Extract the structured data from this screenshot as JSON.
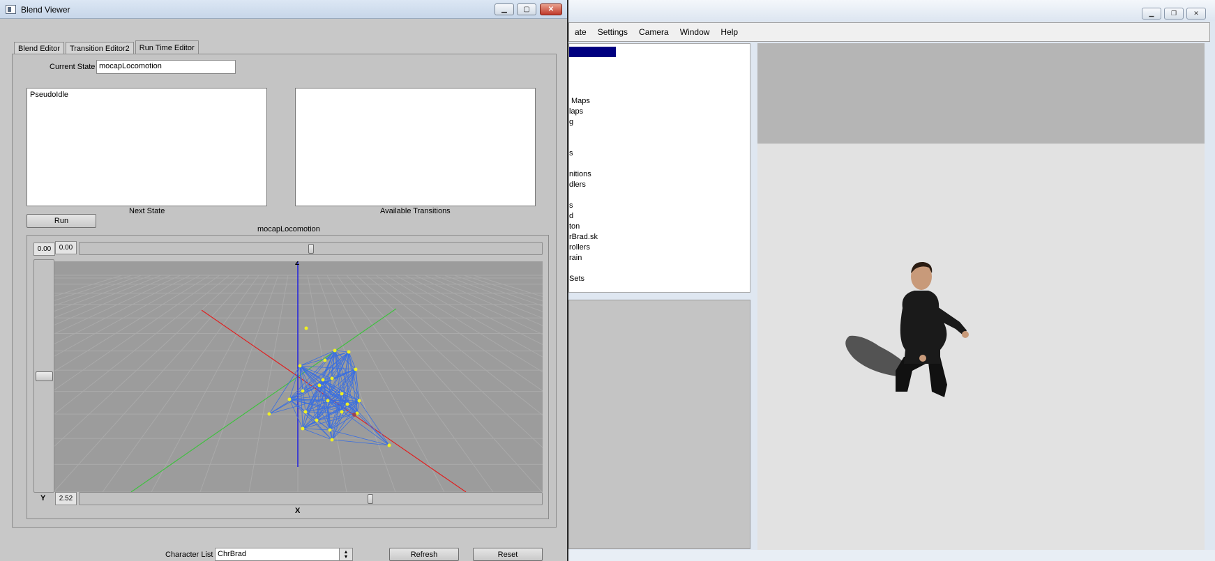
{
  "background_app": {
    "menu": [
      {
        "label": "ate"
      },
      {
        "label": "Settings"
      },
      {
        "label": "Camera"
      },
      {
        "label": "Window"
      },
      {
        "label": "Help"
      }
    ],
    "tree_items": [
      "Maps",
      "laps",
      "g",
      "s",
      "nitions",
      "dlers",
      "s",
      "d",
      "ton",
      "rBrad.sk",
      "rollers",
      "rain",
      "Sets"
    ]
  },
  "blend_viewer": {
    "title": "Blend Viewer",
    "tabs": [
      {
        "label": "Blend Editor",
        "active": false
      },
      {
        "label": "Transition Editor2",
        "active": false
      },
      {
        "label": "Run Time Editor",
        "active": true
      }
    ],
    "current_state_label": "Current State",
    "current_state_value": "mocapLocomotion",
    "next_state_items": [
      "PseudoIdle"
    ],
    "next_state_label": "Next State",
    "available_transitions_items": [],
    "available_transitions_label": "Available Transitions",
    "run_label": "Run",
    "graph_title": "mocapLocomotion",
    "z_value": "0.00",
    "top_slider_value": "0.00",
    "top_slider_position": 0.5,
    "y_axis_label": "Y",
    "vertical_slider_position": 0.5,
    "x_value": "2.52",
    "bottom_slider_position": 0.63,
    "x_axis_label": "X",
    "z_axis_label": "Z",
    "character_list_label": "Character List",
    "character_value": "ChrBrad",
    "refresh_label": "Refresh",
    "reset_label": "Reset"
  },
  "colors": {
    "selection": "#000080",
    "x_axis": "#e02020",
    "y_axis": "#40c040",
    "z_axis": "#2020e0",
    "mesh": "#3a6fe0",
    "vertex": "#f0f020"
  }
}
